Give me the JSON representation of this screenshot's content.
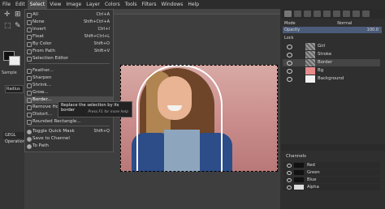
{
  "menubar": [
    "File",
    "Edit",
    "Select",
    "View",
    "Image",
    "Layer",
    "Colors",
    "Tools",
    "Filters",
    "Windows",
    "Help"
  ],
  "active_menu": "Select",
  "toolbox": {
    "sample_label": "Sample",
    "radius_label": "Radius",
    "gegl_label": "GEGL Operation"
  },
  "select_menu": [
    {
      "label": "All",
      "shortcut": "Ctrl+A",
      "icon": "select-all-icon"
    },
    {
      "label": "None",
      "shortcut": "Shift+Ctrl+A",
      "icon": "select-none-icon"
    },
    {
      "label": "Invert",
      "shortcut": "Ctrl+I",
      "icon": "invert-icon"
    },
    {
      "label": "Float",
      "shortcut": "Shift+Ctrl+L",
      "icon": "float-icon"
    },
    {
      "label": "By Color",
      "shortcut": "Shift+O",
      "icon": "by-color-icon"
    },
    {
      "label": "From Path",
      "shortcut": "Shift+V",
      "icon": "path-icon"
    },
    {
      "label": "Selection Editor",
      "shortcut": "",
      "icon": "selection-editor-icon"
    },
    {
      "label": "Feather...",
      "shortcut": "",
      "icon": "feather-icon"
    },
    {
      "label": "Sharpen",
      "shortcut": "",
      "icon": "sharpen-icon"
    },
    {
      "label": "Shrink...",
      "shortcut": "",
      "icon": "shrink-icon"
    },
    {
      "label": "Grow...",
      "shortcut": "",
      "icon": "grow-icon"
    },
    {
      "label": "Border...",
      "shortcut": "",
      "icon": "border-icon"
    },
    {
      "label": "Remove Holes",
      "shortcut": "",
      "icon": "remove-holes-icon"
    },
    {
      "label": "Distort...",
      "shortcut": "",
      "icon": "distort-icon"
    },
    {
      "label": "Rounded Rectangle...",
      "shortcut": "",
      "icon": "rounded-rectangle-icon"
    },
    {
      "label": "Toggle Quick Mask",
      "shortcut": "Shift+Q",
      "icon": "quick-mask-icon"
    },
    {
      "label": "Save to Channel",
      "shortcut": "",
      "icon": "save-channel-icon"
    },
    {
      "label": "To Path",
      "shortcut": "",
      "icon": "to-path-icon"
    }
  ],
  "tooltip": {
    "text": "Replace the selection by its border",
    "hint": "Press F1 for more help"
  },
  "layers_panel": {
    "mode_label": "Mode",
    "mode_value": "Normal",
    "opacity_label": "Opacity",
    "opacity_value": "100.0",
    "lock_label": "Lock",
    "layers": [
      {
        "name": "Girl",
        "thumb": "checker",
        "selected": false
      },
      {
        "name": "Stroke",
        "thumb": "checker",
        "selected": false
      },
      {
        "name": "Border",
        "thumb": "checker",
        "selected": true
      },
      {
        "name": "Bg",
        "thumb": "pink",
        "selected": false
      },
      {
        "name": "Background",
        "thumb": "white",
        "selected": false
      }
    ]
  },
  "channels_panel": {
    "title": "Channels",
    "channels": [
      {
        "name": "Red",
        "thumb": "black"
      },
      {
        "name": "Green",
        "thumb": "black"
      },
      {
        "name": "Blue",
        "thumb": "black"
      },
      {
        "name": "Alpha",
        "thumb": "alpha"
      }
    ]
  }
}
